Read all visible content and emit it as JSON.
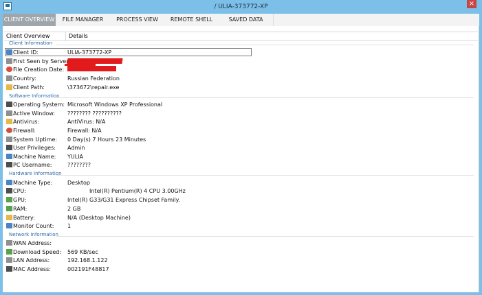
{
  "window": {
    "title": "/ ULIA-373772-XP",
    "close_symbol": "×"
  },
  "tabs": [
    "CLIENT OVERVIEW",
    "FILE MANAGER",
    "PROCESS VIEW",
    "REMOTE SHELL",
    "SAVED DATA"
  ],
  "table": {
    "headers": {
      "name": "Client Overview",
      "details": "Details"
    }
  },
  "sections": {
    "client": {
      "title": "Client Information"
    },
    "software": {
      "title": "Software Information"
    },
    "hardware": {
      "title": "Hardware Information"
    },
    "network": {
      "title": "Network Information"
    }
  },
  "rows": {
    "client_id": {
      "label": "Client ID:",
      "value": "ULIA-373772-XP",
      "icon": "id-icon"
    },
    "first_seen": {
      "label": "First Seen by Server:",
      "value": "",
      "icon": "clock-icon"
    },
    "file_creation": {
      "label": "File Creation Date:",
      "value": "",
      "icon": "calendar-icon"
    },
    "country": {
      "label": "Country:",
      "value": "Russian Federation",
      "icon": "flag-icon"
    },
    "client_path": {
      "label": "Client Path:",
      "value": "\\373672\\repair.exe",
      "icon": "folder-icon"
    },
    "os": {
      "label": "Operating System:",
      "value": "Microsoft Windows XP Professional",
      "icon": "computer-icon"
    },
    "active_window": {
      "label": "Active Window:",
      "value": "???????? ??????????",
      "icon": "window-icon"
    },
    "antivirus": {
      "label": "Antivirus:",
      "value": "AntiVirus: N/A",
      "icon": "shield-icon"
    },
    "firewall": {
      "label": "Firewall:",
      "value": "Firewall: N/A",
      "icon": "firewall-icon"
    },
    "uptime": {
      "label": "System Uptime:",
      "value": "0 Day(s) 7 Hours 23 Minutes",
      "icon": "uptime-icon"
    },
    "user_privileges": {
      "label": "User Privileges:",
      "value": "Admin",
      "icon": "user-icon"
    },
    "machine_name": {
      "label": "Machine Name:",
      "value": "YULIA",
      "icon": "person-icon"
    },
    "pc_username": {
      "label": "PC Username:",
      "value": "????????",
      "icon": "user-icon"
    },
    "machine_type": {
      "label": "Machine Type:",
      "value": "Desktop",
      "icon": "desktop-icon"
    },
    "cpu": {
      "label": "CPU:",
      "value": "Intel(R) Pentium(R) 4 CPU 3.00GHz",
      "icon": "cpu-icon"
    },
    "gpu": {
      "label": "GPU:",
      "value": "Intel(R) G33/G31 Express Chipset Family.",
      "icon": "gpu-icon"
    },
    "ram": {
      "label": "RAM:",
      "value": "2 GB",
      "icon": "ram-icon"
    },
    "battery": {
      "label": "Battery:",
      "value": "N/A (Desktop Machine)",
      "icon": "battery-icon"
    },
    "monitor_count": {
      "label": "Monitor Count:",
      "value": "1",
      "icon": "monitor-icon"
    },
    "wan_address": {
      "label": "WAN Address:",
      "value": "",
      "icon": "wan-icon"
    },
    "download_speed": {
      "label": "Download Speed:",
      "value": "569 KB/sec",
      "icon": "download-icon"
    },
    "lan_address": {
      "label": "LAN Address:",
      "value": "192.168.1.122",
      "icon": "lan-icon"
    },
    "mac_address": {
      "label": "MAC Address:",
      "value": "002191F48817",
      "icon": "network-card-icon"
    }
  },
  "colors": {
    "accent": "#9ea5ab",
    "section_text": "#2d69a6",
    "redaction": "#e31a1c",
    "background": "#7cc0ea"
  }
}
